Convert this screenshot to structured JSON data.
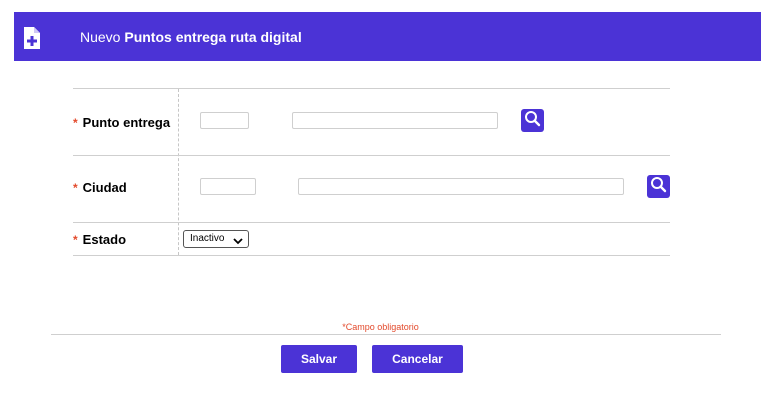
{
  "header": {
    "prefix": "Nuevo",
    "title": "Puntos entrega ruta digital",
    "icon": "file-plus-icon"
  },
  "required_mark": "*",
  "fields": {
    "punto_entrega": {
      "label": "Punto entrega",
      "code_value": "",
      "description_value": "",
      "search_icon": "search-icon"
    },
    "ciudad": {
      "label": "Ciudad",
      "code_value": "",
      "description_value": "",
      "search_icon": "search-icon"
    },
    "estado": {
      "label": "Estado",
      "selected": "Inactivo"
    }
  },
  "legend": "*Campo obligatorio",
  "actions": {
    "save": "Salvar",
    "cancel": "Cancelar"
  },
  "colors": {
    "accent": "#4b33d6",
    "required": "#e34a2c"
  }
}
